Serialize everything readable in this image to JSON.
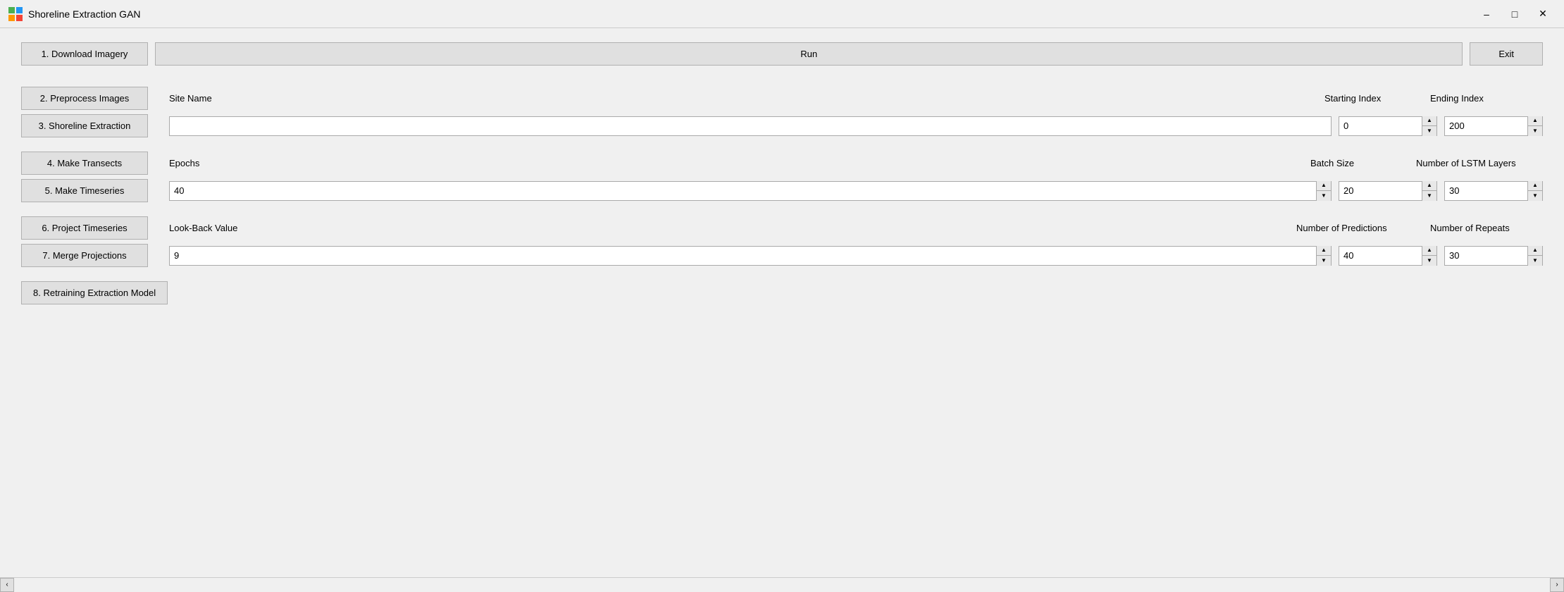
{
  "titleBar": {
    "title": "Shoreline Extraction GAN",
    "iconColor": "#4CAF50",
    "minimizeLabel": "minimize",
    "maximizeLabel": "maximize",
    "closeLabel": "close"
  },
  "toolbar": {
    "runLabel": "Run",
    "exitLabel": "Exit"
  },
  "navButtons": [
    {
      "id": "download",
      "label": "1. Download Imagery"
    },
    {
      "id": "preprocess",
      "label": "2. Preprocess Images"
    },
    {
      "id": "shoreline",
      "label": "3. Shoreline Extraction"
    },
    {
      "id": "transects",
      "label": "4. Make Transects"
    },
    {
      "id": "timeseries",
      "label": "5. Make Timeseries"
    },
    {
      "id": "project",
      "label": "6. Project Timeseries"
    },
    {
      "id": "merge",
      "label": "7. Merge Projections"
    },
    {
      "id": "retrain",
      "label": "8. Retraining Extraction Model"
    }
  ],
  "form": {
    "siteNameLabel": "Site Name",
    "startingIndexLabel": "Starting Index",
    "endingIndexLabel": "Ending Index",
    "siteNameValue": "",
    "startingIndexValue": "0",
    "endingIndexValue": "200",
    "epochsLabel": "Epochs",
    "batchSizeLabel": "Batch Size",
    "lstmLayersLabel": "Number of LSTM Layers",
    "epochsValue": "40",
    "batchSizeValue": "20",
    "lstmLayersValue": "30",
    "lookBackLabel": "Look-Back Value",
    "predictionsLabel": "Number of Predictions",
    "repeatsLabel": "Number of Repeats",
    "lookBackValue": "9",
    "predictionsValue": "40",
    "repeatsValue": "30"
  },
  "scrollbar": {
    "leftArrow": "‹",
    "rightArrow": "›"
  }
}
